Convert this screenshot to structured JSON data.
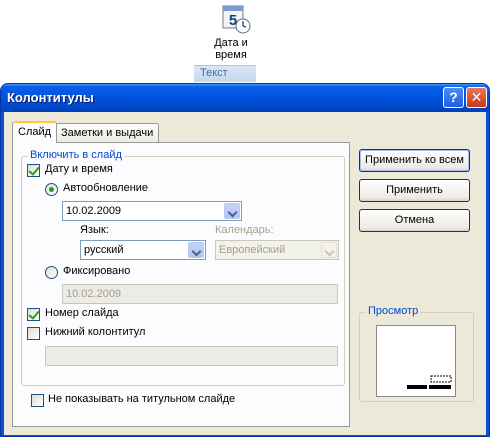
{
  "ribbon": {
    "button_line1": "Дата и",
    "button_line2": "время",
    "icon_digit": "5",
    "group_label": "Текст"
  },
  "dialog": {
    "title": "Колонтитулы",
    "help_label": "?",
    "close_label": "✕",
    "tabs": [
      {
        "label": "Слайд",
        "active": true
      },
      {
        "label": "Заметки и выдачи",
        "active": false
      }
    ],
    "include_group": "Включить в слайд",
    "date_time": {
      "label": "Дату и время",
      "checked": true
    },
    "auto_update": {
      "label": "Автообновление",
      "selected": true
    },
    "auto_date_value": "10.02.2009",
    "language_label": "Язык:",
    "language_value": "русский",
    "calendar_label": "Календарь:",
    "calendar_value": "Европейский",
    "fixed": {
      "label": "Фиксировано",
      "selected": false
    },
    "fixed_value": "10.02.2009",
    "slide_number": {
      "label": "Номер слайда",
      "checked": true
    },
    "footer": {
      "label": "Нижний колонтитул",
      "checked": false,
      "value": ""
    },
    "dont_show_title": {
      "label": "Не показывать на титульном слайде",
      "checked": false
    },
    "buttons": {
      "apply_all": "Применить ко всем",
      "apply": "Применить",
      "cancel": "Отмена"
    },
    "preview_label": "Просмотр"
  },
  "colors": {
    "title_blue": "#0054e3",
    "dialog_bg": "#ece9d8",
    "group_label_blue": "#0046d5",
    "check_green": "#21a121"
  }
}
